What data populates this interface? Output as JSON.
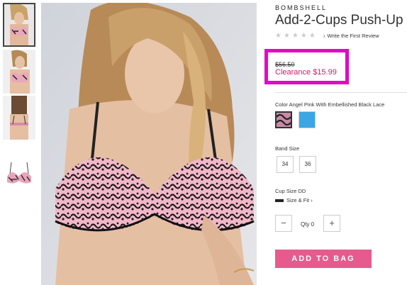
{
  "product": {
    "brand": "BOMBSHELL",
    "title": "Add-2-Cups Push-Up",
    "stars": "★★★★★",
    "review_link": "Write the First Review",
    "original_price": "$56.50",
    "sale_price": "Clearance $15.99",
    "color_label": "Color Angel Pink With Embellished Black Lace",
    "band_label": "Band Size",
    "band_sizes": [
      "34",
      "36"
    ],
    "cup_label": "Cup Size DD",
    "size_fit": "Size & Fit",
    "qty_label": "Qty 0",
    "qty_minus": "−",
    "qty_plus": "+",
    "add_to_bag": "ADD TO BAG"
  },
  "colors": {
    "highlight_box": "#e10ac5",
    "sale_price": "#d0196b",
    "add_button": "#e75a8e",
    "swatch_pink_black": "#2b2430",
    "swatch_blue": "#3aa6e6"
  },
  "icons": {
    "favorite": "heart-icon",
    "review_chevron": "chevron-right-icon",
    "size_fit_chevron": "chevron-right-icon"
  }
}
